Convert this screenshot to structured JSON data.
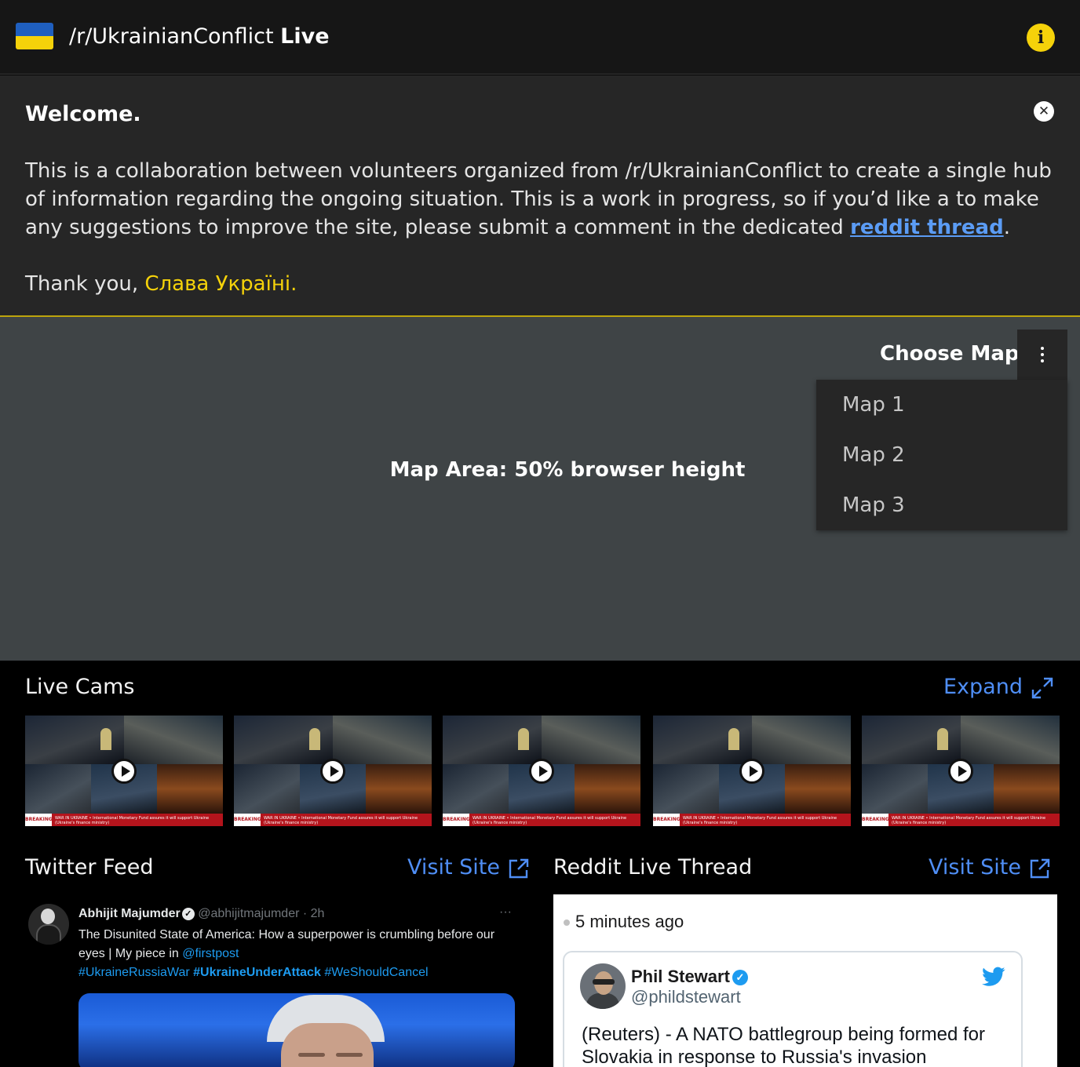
{
  "header": {
    "subreddit": "/r/UkrainianConflict",
    "live": "Live",
    "info_icon": "i"
  },
  "welcome": {
    "title": "Welcome.",
    "body_text": "This is a collaboration between volunteers organized from /r/UkrainianConflict to create a single hub of information regarding the ongoing situation. This is a work in progress, so if you’d like a to make any suggestions to improve the site, please submit a comment in the dedicated ",
    "link_text": "reddit thread",
    "body_end": ".",
    "thanks": "Thank you, ",
    "slava": "Слава Україні."
  },
  "map": {
    "placeholder": "Map Area: 50% browser height",
    "choose_label": "Choose Map",
    "options": [
      "Map 1",
      "Map 2",
      "Map 3"
    ]
  },
  "live_cams": {
    "title": "Live Cams",
    "expand_label": "Expand",
    "cams": [
      {
        "breaking": "BREAKING",
        "ticker": "WAR IN UKRAINE • International Monetary Fund assures it will support Ukraine (Ukraine's finance ministry)"
      },
      {
        "breaking": "BREAKING",
        "ticker": "WAR IN UKRAINE • International Monetary Fund assures it will support Ukraine (Ukraine's finance ministry)"
      },
      {
        "breaking": "BREAKING",
        "ticker": "WAR IN UKRAINE • International Monetary Fund assures it will support Ukraine (Ukraine's finance ministry)"
      },
      {
        "breaking": "BREAKING",
        "ticker": "WAR IN UKRAINE • International Monetary Fund assures it will support Ukraine (Ukraine's finance ministry)"
      },
      {
        "breaking": "BREAKING",
        "ticker": "WAR IN UKRAINE • International Monetary Fund assures it will support Ukraine (Ukraine's finance ministry)"
      }
    ]
  },
  "twitter": {
    "title": "Twitter Feed",
    "visit_label": "Visit Site",
    "tweet": {
      "name": "Abhijit Majumder",
      "handle": "@abhijitmajumder · 2h",
      "more": "···",
      "text_1": "The Disunited State of America: How a superpower is crumbling before our eyes | My piece in ",
      "mention": "@firstpost",
      "hashtag_1": "#UkraineRussiaWar",
      "hashtag_2": "#UkraineUnderAttack",
      "hashtag_3": "#WeShouldCancel"
    }
  },
  "reddit": {
    "title": "Reddit Live Thread",
    "visit_label": "Visit Site",
    "time_ago": "5 minutes ago",
    "embed": {
      "name": "Phil Stewart",
      "handle": "@phildstewart",
      "text": "(Reuters) - A NATO battlegroup being formed for Slovakia in response to Russia's invasion"
    }
  },
  "colors": {
    "accent_yellow": "#f5d20a",
    "link_blue": "#4f8ef5",
    "flag_blue": "#1f5fbf"
  }
}
